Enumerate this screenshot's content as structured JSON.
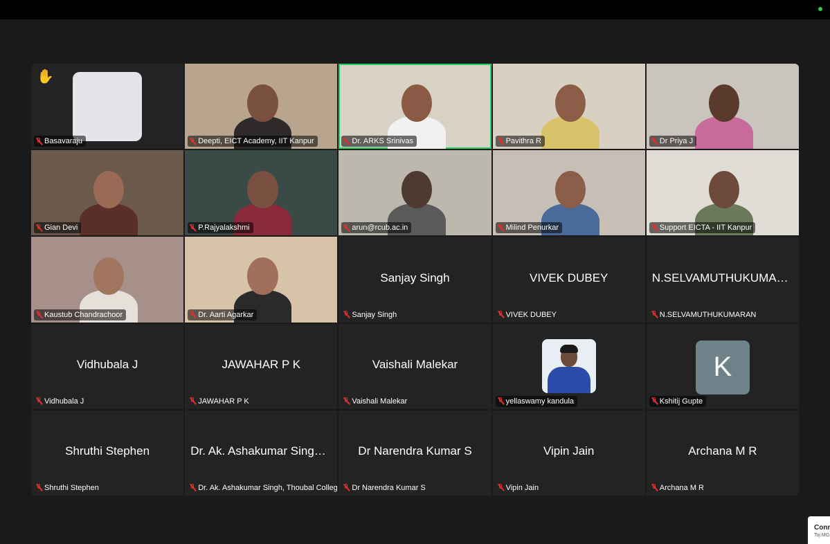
{
  "window": {
    "status": "connected"
  },
  "participants": [
    {
      "label": "Basavaraju",
      "center": "",
      "type": "avatar-blank",
      "hand": true
    },
    {
      "label": "Deepti, EICT Academy, IIT Kanpur",
      "center": "",
      "type": "video",
      "bg": "#b9a58e",
      "skin": "#7a5040",
      "cloth": "#2e2a2a"
    },
    {
      "label": "Dr. ARKS Srinivas",
      "center": "",
      "type": "video",
      "bg": "#d8d2c6",
      "skin": "#8a5a44",
      "cloth": "#f1f1f1",
      "active": true
    },
    {
      "label": "Pavithra R",
      "center": "",
      "type": "video",
      "bg": "#d9d0c4",
      "skin": "#8d5e47",
      "cloth": "#d8c26a"
    },
    {
      "label": "Dr Priya J",
      "center": "",
      "type": "video",
      "bg": "#c9c4bd",
      "skin": "#5b3a2e",
      "cloth": "#c86a9a"
    },
    {
      "label": "Gian Devi",
      "center": "",
      "type": "video",
      "bg": "#6b5a4c",
      "skin": "#9b6a55",
      "cloth": "#5a2f2a"
    },
    {
      "label": "P.Rajyalakshmi",
      "center": "",
      "type": "video",
      "bg": "#3a4a46",
      "skin": "#7a5040",
      "cloth": "#8a2a3a"
    },
    {
      "label": "arun@rcub.ac.in",
      "center": "",
      "type": "video",
      "bg": "#bdb8ae",
      "skin": "#4e3a30",
      "cloth": "#5a5a5a"
    },
    {
      "label": "Milind Penurkar",
      "center": "",
      "type": "video",
      "bg": "#c7bfb5",
      "skin": "#8a5e48",
      "cloth": "#4a6a9a"
    },
    {
      "label": "Support EICTA - IIT Kanpur",
      "center": "",
      "type": "video",
      "bg": "#e0ddd6",
      "skin": "#6e4a3a",
      "cloth": "#6a7a5a"
    },
    {
      "label": "Kaustub Chandrachoor",
      "center": "",
      "type": "video",
      "bg": "#a8908a",
      "skin": "#a0765e",
      "cloth": "#e6e0da"
    },
    {
      "label": "Dr. Aarti Agarkar",
      "center": "",
      "type": "video",
      "bg": "#d6c3a8",
      "skin": "#a0705a",
      "cloth": "#2a2a2a"
    },
    {
      "label": "Sanjay Singh",
      "center": "Sanjay Singh",
      "type": "empty"
    },
    {
      "label": "VIVEK DUBEY",
      "center": "VIVEK DUBEY",
      "type": "empty"
    },
    {
      "label": "N.SELVAMUTHUKUMARAN",
      "center": "N.SELVAMUTHUKUMARAN",
      "type": "empty"
    },
    {
      "label": "Vidhubala J",
      "center": "Vidhubala J",
      "type": "empty"
    },
    {
      "label": "JAWAHAR P K",
      "center": "JAWAHAR P K",
      "type": "empty"
    },
    {
      "label": "Vaishali Malekar",
      "center": "Vaishali Malekar",
      "type": "empty"
    },
    {
      "label": "yellaswamy kandula",
      "center": "",
      "type": "avatar-photo"
    },
    {
      "label": "Kshitij Gupte",
      "center": "",
      "type": "avatar-letter",
      "letter": "K"
    },
    {
      "label": "Shruthi Stephen",
      "center": "Shruthi Stephen",
      "type": "empty"
    },
    {
      "label": "Dr. Ak. Ashakumar Singh, Thoubal College",
      "center": "Dr. Ak. Ashakumar Singh,...",
      "type": "empty"
    },
    {
      "label": "Dr Narendra Kumar S",
      "center": "Dr Narendra Kumar S",
      "type": "empty"
    },
    {
      "label": "Vipin Jain",
      "center": "Vipin Jain",
      "type": "empty"
    },
    {
      "label": "Archana M R",
      "center": "Archana M R",
      "type": "empty"
    }
  ],
  "popup": {
    "title": "Conn",
    "sub": "Toj MG"
  }
}
